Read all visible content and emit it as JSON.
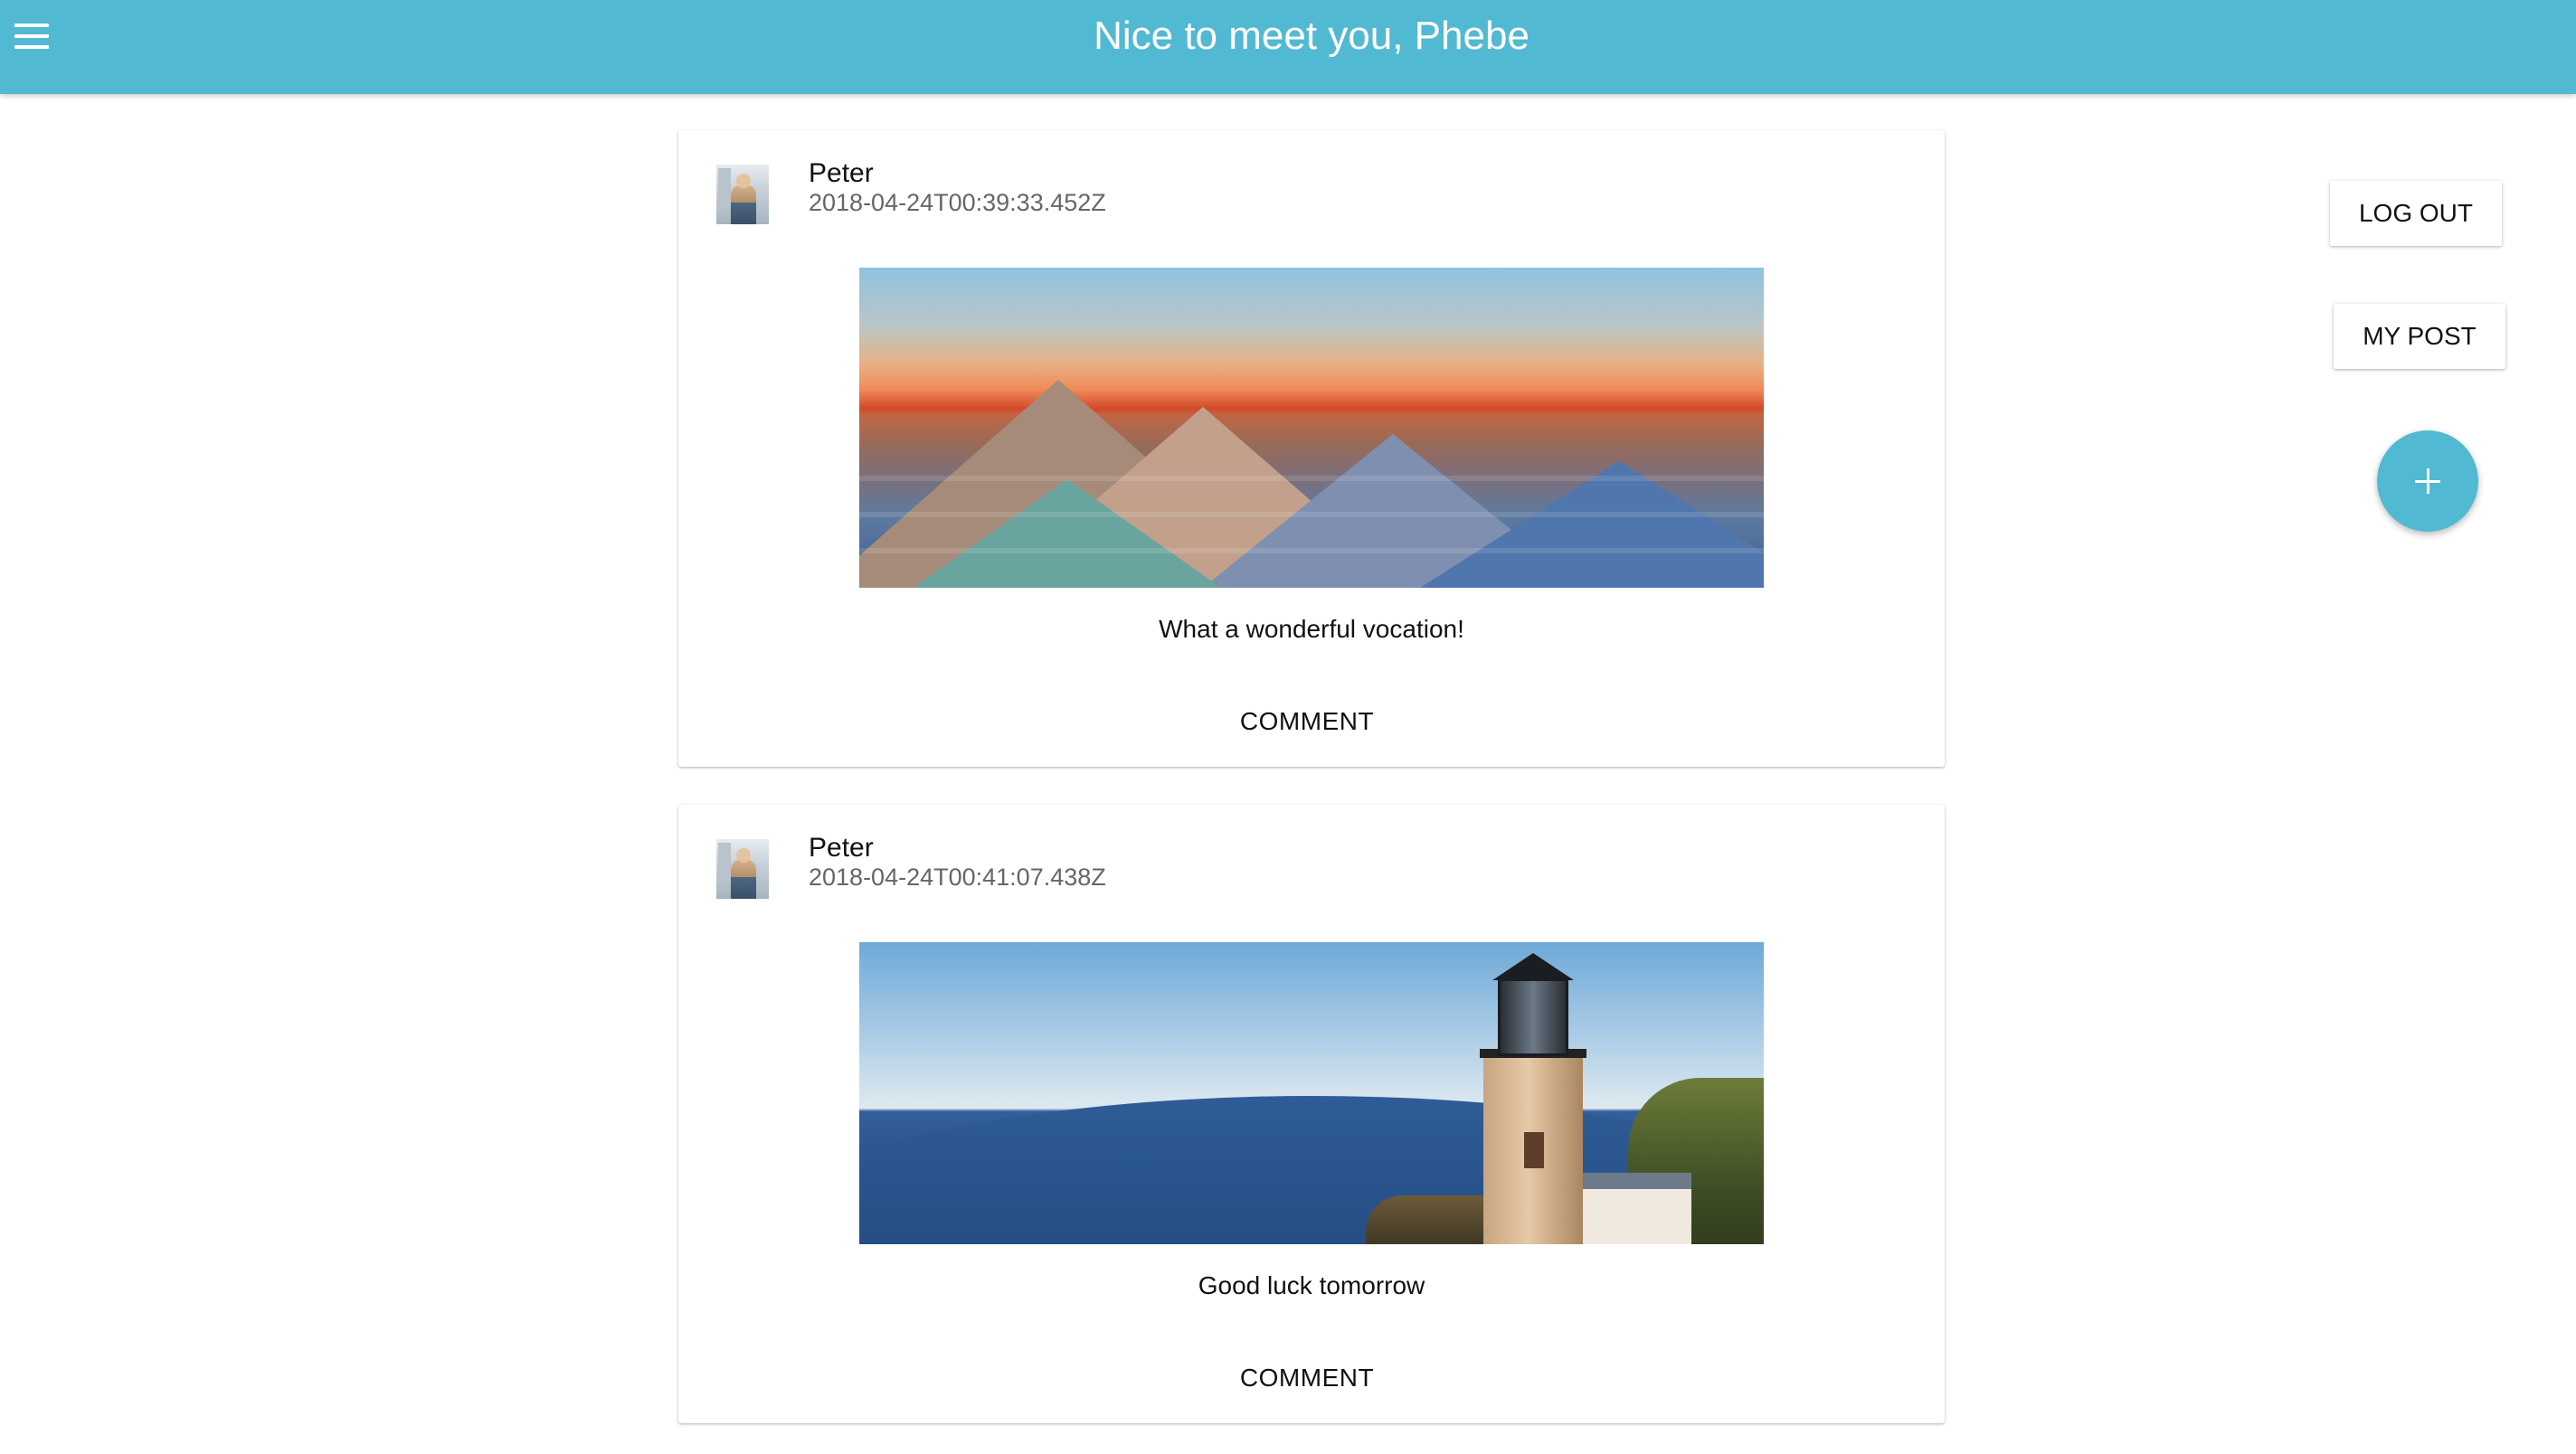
{
  "app_bar": {
    "title": "Nice to meet you, Phebe",
    "menu_icon": "menu-icon",
    "color": "#52b9d2"
  },
  "posts": [
    {
      "author": "Peter",
      "timestamp": "2018-04-24T00:39:33.452Z",
      "image_subject": "badlands landscape at sunset",
      "caption": "What a wonderful vocation!",
      "comment_label": "COMMENT"
    },
    {
      "author": "Peter",
      "timestamp": "2018-04-24T00:41:07.438Z",
      "image_subject": "lighthouse over lake",
      "caption": "Good luck tomorrow",
      "comment_label": "COMMENT"
    }
  ],
  "side_actions": {
    "logout_label": "LOG OUT",
    "my_post_label": "MY POST",
    "add_icon": "plus-icon"
  }
}
